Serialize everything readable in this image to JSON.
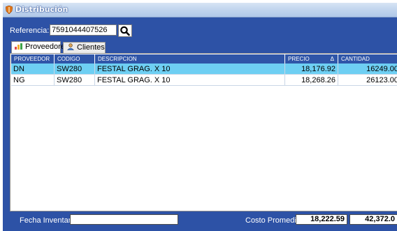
{
  "window": {
    "title": "Distribución"
  },
  "search": {
    "label": "Referencia:",
    "value": "7591044407526"
  },
  "tabs": [
    {
      "label": "Proveedores",
      "icon": "providers-icon",
      "active": true
    },
    {
      "label": "Clientes",
      "icon": "clients-icon",
      "active": false
    }
  ],
  "grid": {
    "columns": [
      "PROVEEDOR",
      "CODIGO",
      "DESCRIPCION",
      "PRECIO",
      "Δ",
      "CANTIDAD"
    ],
    "rows": [
      {
        "proveedor": "DN",
        "codigo": "SW280",
        "descripcion": "FESTAL GRAG. X 10",
        "precio": "18,176.92",
        "cantidad": "16249.00",
        "selected": true
      },
      {
        "proveedor": "NG",
        "codigo": "SW280",
        "descripcion": "FESTAL GRAG. X 10",
        "precio": "18,268.26",
        "cantidad": "26123.00",
        "selected": false
      }
    ]
  },
  "footer": {
    "fecha_label": "Fecha Inventario:",
    "fecha_value": "",
    "costo_label": "Costo Promedio:",
    "costo_value": "18,222.59",
    "cantidad_total": "42,372.0"
  },
  "colors": {
    "window_bg": "#2d52a6",
    "header_bg": "#2f55a8",
    "selected_row": "#6ecff3"
  }
}
